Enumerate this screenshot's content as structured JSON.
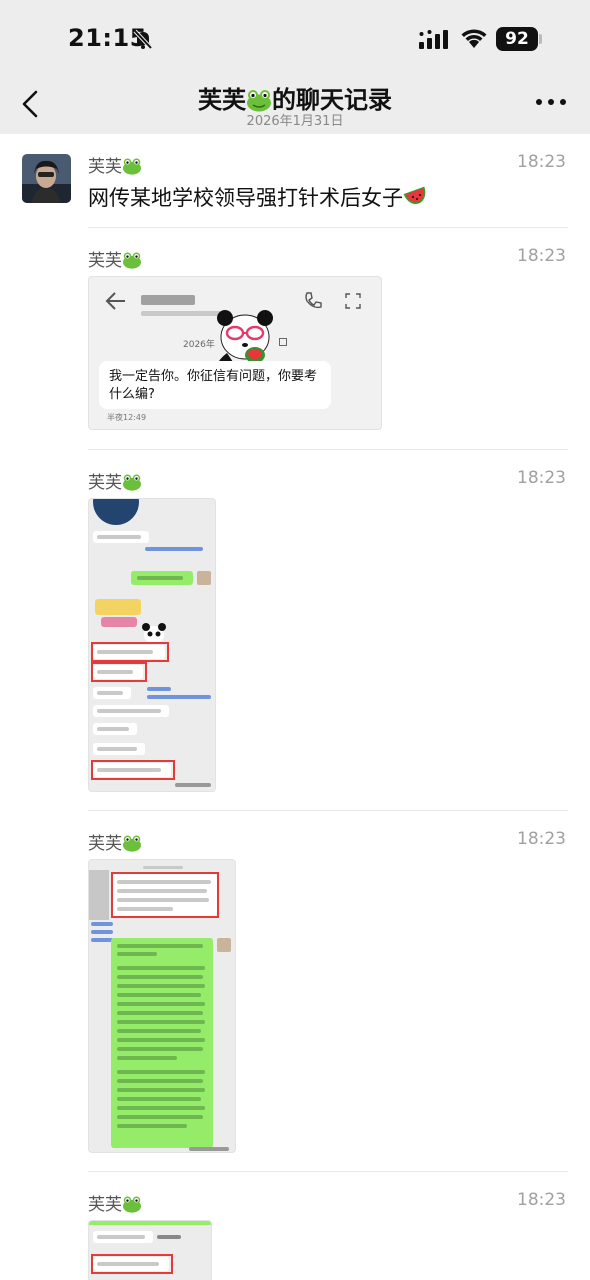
{
  "status_bar": {
    "time": "21:15",
    "battery": "92"
  },
  "header": {
    "title_prefix": "芙芙",
    "title_suffix": "的聊天记录",
    "subtitle": "2026年1月31日"
  },
  "messages": [
    {
      "sender": "芙芙",
      "time": "18:23",
      "text": "网传某地学校领导强打针术后女子"
    },
    {
      "sender": "芙芙",
      "time": "18:23"
    },
    {
      "sender": "芙芙",
      "time": "18:23"
    },
    {
      "sender": "芙芙",
      "time": "18:23"
    },
    {
      "sender": "芙芙",
      "time": "18:23"
    }
  ],
  "screenshot1": {
    "date_stub": "2026年",
    "message": "我一定告你。你征信有问题，你要考什么编?",
    "meta": "半夜12:49"
  },
  "colors": {
    "header_bg": "#ededed",
    "bubble_green": "#95ec69",
    "highlight_red": "#e23b3b"
  }
}
